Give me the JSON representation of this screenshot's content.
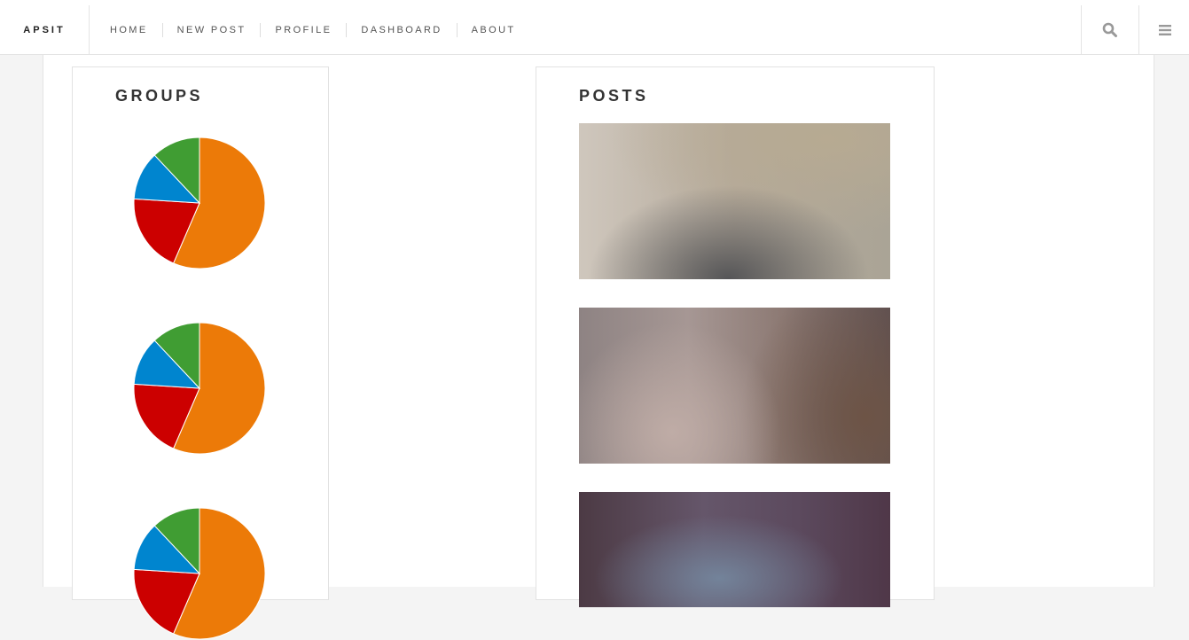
{
  "nav": {
    "brand": "APSIT",
    "links": [
      "HOME",
      "NEW POST",
      "PROFILE",
      "DASHBOARD",
      "ABOUT"
    ],
    "search_icon": "search-icon",
    "menu_icon": "hamburger-menu-icon"
  },
  "groups": {
    "title": "GROUPS",
    "chart_data": {
      "type": "pie",
      "slices": [
        {
          "value": 56.5,
          "color": "#ec7a08"
        },
        {
          "value": 19.5,
          "color": "#cc0000"
        },
        {
          "value": 12,
          "color": "#0085cf"
        },
        {
          "value": 12,
          "color": "#409d33"
        }
      ],
      "count": 3
    }
  },
  "posts": {
    "title": "POSTS",
    "items": [
      {
        "image": "post-image-1"
      },
      {
        "image": "post-image-2"
      },
      {
        "image": "post-image-3"
      }
    ]
  }
}
